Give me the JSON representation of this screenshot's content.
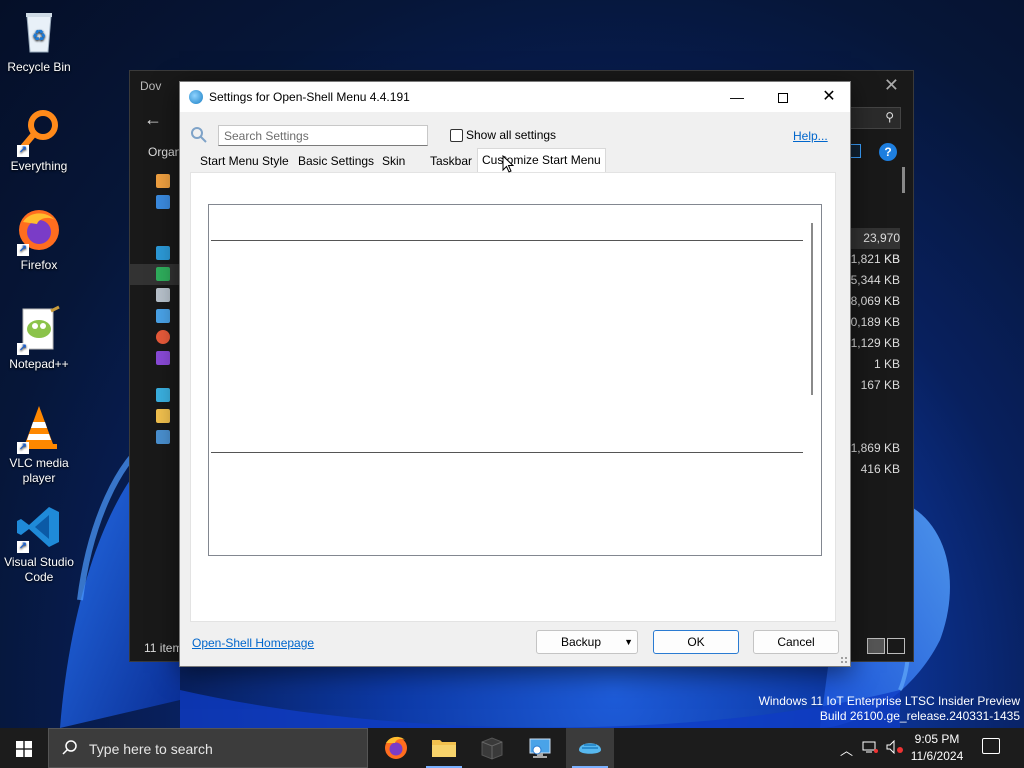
{
  "desktop": {
    "icons": [
      {
        "label": "Recycle Bin",
        "icon": "recycle-bin-icon"
      },
      {
        "label": "Everything",
        "icon": "everything-icon"
      },
      {
        "label": "Firefox",
        "icon": "firefox-icon"
      },
      {
        "label": "Notepad++",
        "icon": "notepadpp-icon"
      },
      {
        "label": "VLC media player",
        "icon": "vlc-icon"
      },
      {
        "label": "Visual Studio Code",
        "icon": "vscode-icon"
      }
    ],
    "watermark": {
      "line1": "Windows 11 IoT Enterprise LTSC Insider Preview",
      "line2": "Build 26100.ge_release.240331-1435"
    }
  },
  "explorer": {
    "title": "Dov",
    "toolbar_label": "Organ",
    "sizes": [
      "23,970 KB",
      "1,821 KB",
      "5,344 KB",
      "8,069 KB",
      "0,189 KB",
      "1,129 KB",
      "1 KB",
      "167 KB",
      "",
      "",
      "1,869 KB",
      "416 KB"
    ],
    "status": "11 item"
  },
  "dialog": {
    "title": "Settings for Open-Shell Menu 4.4.191",
    "search_placeholder": "Search Settings",
    "show_all_label": "Show all settings",
    "show_all_checked": false,
    "help_label": "Help...",
    "tabs": [
      {
        "label": "Start Menu Style",
        "active": false
      },
      {
        "label": "Basic Settings",
        "active": false
      },
      {
        "label": "Skin",
        "active": false
      },
      {
        "label": "Taskbar",
        "active": false
      },
      {
        "label": "Customize Start Menu",
        "active": true
      }
    ],
    "homepage_label": "Open-Shell Homepage",
    "buttons": {
      "backup": "Backup",
      "ok": "OK",
      "cancel": "Cancel"
    }
  },
  "taskbar": {
    "search_placeholder": "Type here to search",
    "apps": [
      {
        "name": "Firefox",
        "icon": "firefox-icon"
      },
      {
        "name": "File Explorer",
        "icon": "folder-icon"
      },
      {
        "name": "App",
        "icon": "box-icon"
      },
      {
        "name": "Remote Desktop",
        "icon": "monitor-icon"
      },
      {
        "name": "Open-Shell",
        "icon": "shell-icon"
      }
    ],
    "clock": {
      "time": "9:05 PM",
      "date": "11/6/2024"
    }
  }
}
